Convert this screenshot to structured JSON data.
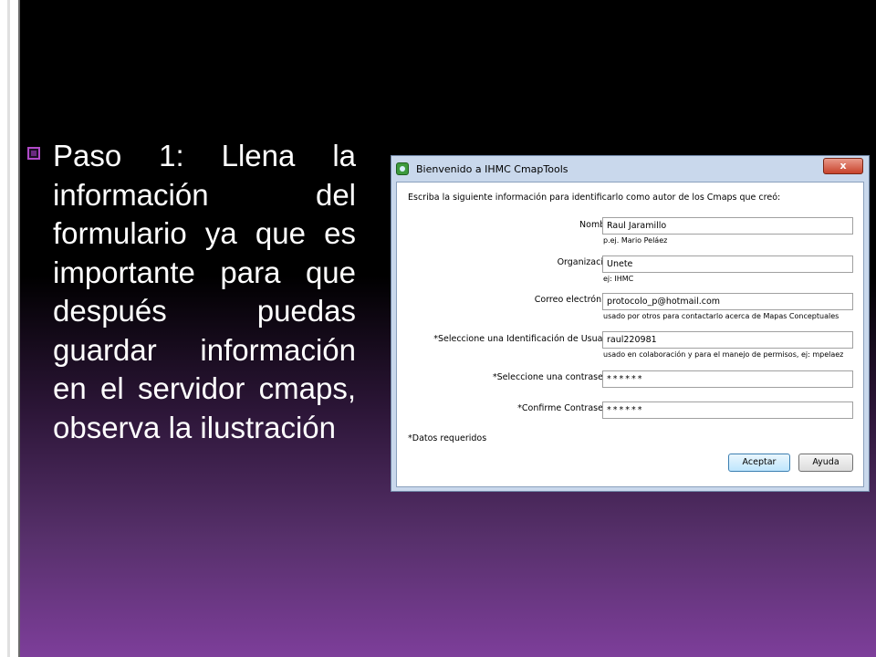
{
  "slide": {
    "body_text": "Paso 1: Llena la información del formulario ya que es importante para que después puedas guardar información en el servidor cmaps, observa la ilustración"
  },
  "dialog": {
    "title": "Bienvenido a IHMC CmapTools",
    "close_glyph": "x",
    "intro": "Escriba la siguiente información para identificarlo como autor de los Cmaps que creó:",
    "fields": [
      {
        "label": "Nombre:",
        "value": "Raul Jaramillo",
        "hint": "p.ej. Mario Peláez"
      },
      {
        "label": "Organización:",
        "value": "Unete",
        "hint": "ej: IHMC"
      },
      {
        "label": "Correo electrónico:",
        "value": "protocolo_p@hotmail.com",
        "hint": "usado por otros para contactarlo acerca de Mapas Conceptuales"
      },
      {
        "label": "*Seleccione una Identificación de Usuario:",
        "value": "raul220981",
        "hint": "usado en colaboración y para el manejo de permisos,  ej: mpelaez"
      },
      {
        "label": "*Seleccione una contraseña:",
        "value": "******"
      },
      {
        "label": "*Confirme Contraseña:",
        "value": "******"
      }
    ],
    "required_note": "*Datos requeridos",
    "buttons": {
      "accept": "Aceptar",
      "help": "Ayuda"
    }
  },
  "colors": {
    "bullet": "#b04ac8",
    "dialog_frame": "#c9d8ec"
  }
}
